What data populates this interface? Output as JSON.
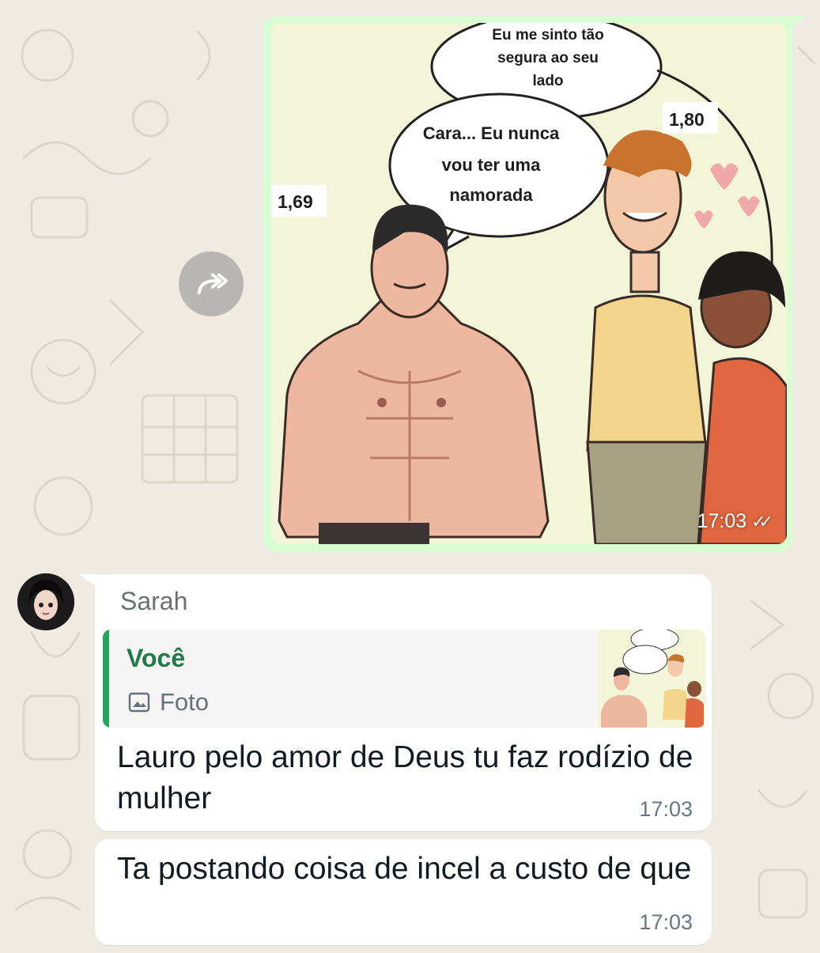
{
  "outgoing_image_message": {
    "time": "17:03",
    "status": "read",
    "ticks_icon": "double-check-icon",
    "comic": {
      "left_figure_height": "1,69",
      "right_figure_height": "1,80",
      "bubble_top": [
        "Eu me sinto tão",
        "segura ao seu",
        "lado"
      ],
      "bubble_middle": [
        "Cara... Eu nunca",
        "vou ter uma",
        "namorada"
      ]
    }
  },
  "forward_button": {
    "icon": "forward-icon"
  },
  "incoming_message_1": {
    "sender": "Sarah",
    "reply_quote": {
      "author": "Você",
      "type_label": "Foto",
      "type_icon": "photo-icon"
    },
    "text": "Lauro pelo amor de Deus tu faz rodízio de mulher",
    "time": "17:03"
  },
  "incoming_message_2": {
    "text": "Ta postando coisa de incel a custo de que",
    "time": "17:03"
  },
  "colors": {
    "outgoing_bubble": "#d9fdd3",
    "incoming_bubble": "#ffffff",
    "quote_accent": "#25a35a",
    "background": "#efeae2"
  }
}
